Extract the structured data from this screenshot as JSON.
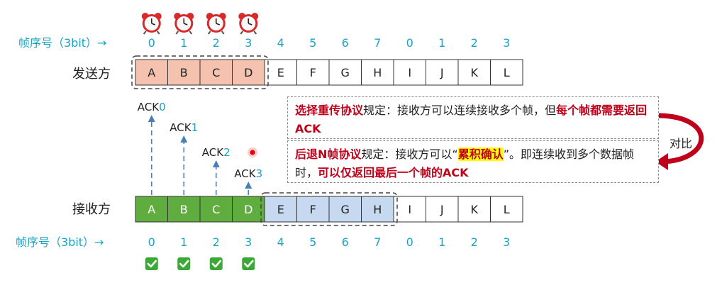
{
  "seq_label_top": "帧序号（3bit）→",
  "seq_label_bottom": "帧序号（3bit）→",
  "sender_label": "发送方",
  "receiver_label": "接收方",
  "seq_numbers": [
    "0",
    "1",
    "2",
    "3",
    "4",
    "5",
    "6",
    "7",
    "0",
    "1",
    "2",
    "3"
  ],
  "frames": [
    "A",
    "B",
    "C",
    "D",
    "E",
    "F",
    "G",
    "H",
    "I",
    "J",
    "K",
    "L"
  ],
  "sender_window_count": 4,
  "receiver_green_count": 4,
  "receiver_blue_count": 4,
  "acks": [
    "ACK0",
    "ACK1",
    "ACK2",
    "ACK3"
  ],
  "alarm_icon": "alarm-clock-icon",
  "check_icon": "green-check-icon",
  "compare_label": "对比",
  "note_sr": {
    "title": "选择重传协议",
    "text1": "规定：接收方可以连续接收多个帧，但",
    "emph": "每个帧都需要返回ACK"
  },
  "note_gbn": {
    "title": "后退N帧协议",
    "text1": "规定：接收方可以“",
    "highlight": "累积确认",
    "text2": "”。即连续收到多个数据帧时，",
    "emph": "可以仅返回最后一个帧的ACK"
  },
  "colors": {
    "sender_fill": "#f4c2ae",
    "receiver_green": "#5fad3e",
    "receiver_blue": "#c6d9f0",
    "cyan": "#1ba3c4",
    "arrow_red": "#c0001a"
  }
}
